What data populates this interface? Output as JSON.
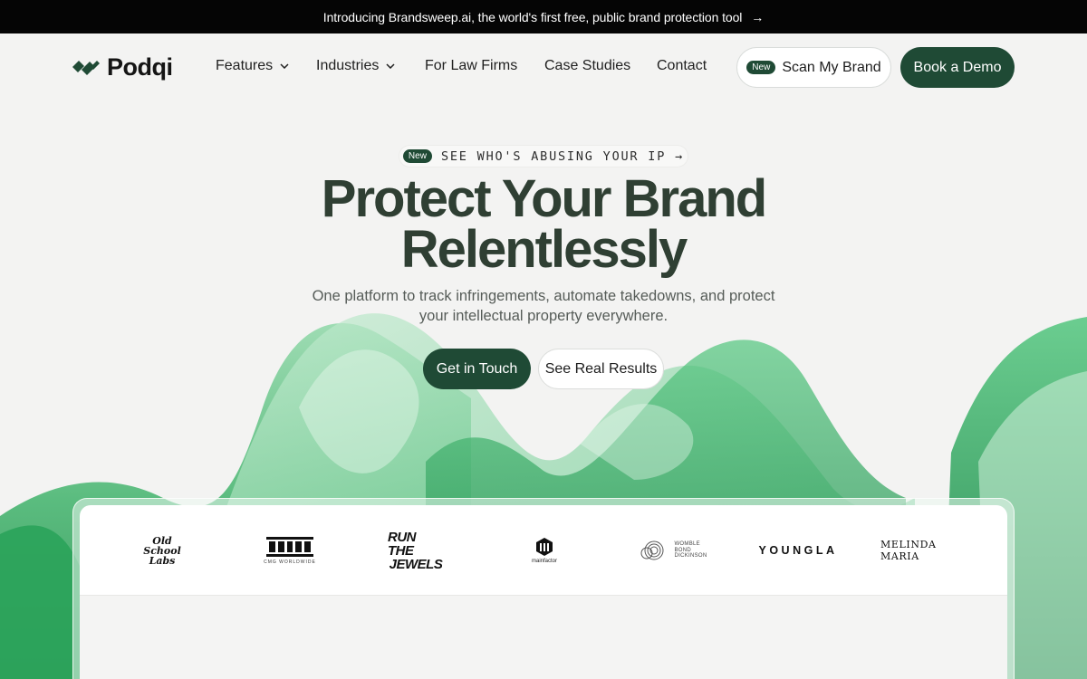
{
  "announcement": {
    "text": "Introducing Brandsweep.ai, the world's first free, public brand protection tool",
    "arrow": "→"
  },
  "brand": {
    "name": "Podqi",
    "accent": "#1f4a35"
  },
  "nav": {
    "features": "Features",
    "industries": "Industries",
    "law_firms": "For Law Firms",
    "case_studies": "Case Studies",
    "contact": "Contact",
    "scan_badge": "New",
    "scan_label": "Scan My Brand",
    "demo_label": "Book a Demo"
  },
  "hero": {
    "eyebrow_badge": "New",
    "eyebrow_text": "SEE WHO'S ABUSING YOUR IP",
    "eyebrow_arrow": "→",
    "title_line1": "Protect Your Brand",
    "title_line2": "Relentlessly",
    "subtitle": "One platform to track infringements, automate takedowns, and protect your intellectual property everywhere.",
    "cta_primary": "Get in Touch",
    "cta_secondary": "See Real Results"
  },
  "client_logos": {
    "oldschool": [
      "Old",
      "School",
      "Labs"
    ],
    "cmg": "CMG WORLDWIDE",
    "rtj": [
      "RUN THE",
      "JEWELS"
    ],
    "mainfactor": "mainfactor",
    "wbd": [
      "WOMBLE",
      "BOND",
      "DICKINSON"
    ],
    "youngla": "YOUNGLA",
    "melinda": "MELINDA MARIA"
  }
}
